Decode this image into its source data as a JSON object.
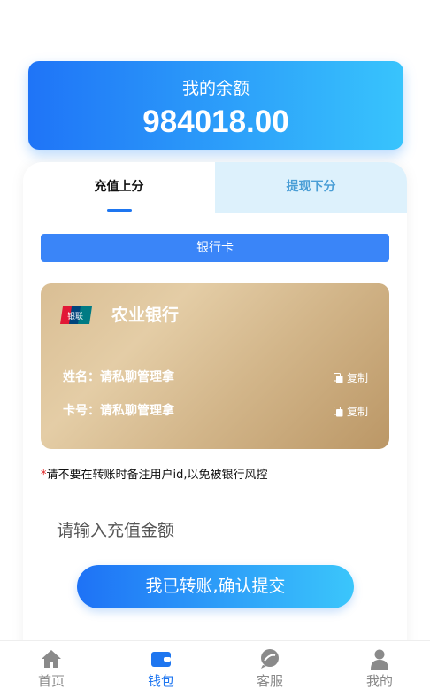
{
  "balance": {
    "title": "我的余额",
    "amount": "984018.00"
  },
  "tabs": {
    "recharge": "充值上分",
    "withdraw": "提现下分"
  },
  "payment_method": "银行卡",
  "bank_card": {
    "icon": "unionpay-logo",
    "bank_name": "农业银行",
    "name_row": "姓名：请私聊管理拿",
    "card_row": "卡号：请私聊管理拿",
    "copy_label": "复制"
  },
  "notice": {
    "star": "*",
    "text": "请不要在转账时备注用户id,以免被银行风控"
  },
  "amount_input": {
    "placeholder": "请输入充值金额",
    "value": ""
  },
  "submit_label": "我已转账,确认提交",
  "colors": {
    "primary_blue": "#1e76f0",
    "gradient_start": "#1f74f7",
    "gradient_end": "#38c4fc",
    "card_gold": "#d2b589",
    "inactive_tab_bg": "#ddf1fc",
    "notice_star": "#e02020"
  },
  "bottom_nav": {
    "home": {
      "label": "首页",
      "icon": "home-icon"
    },
    "wallet": {
      "label": "钱包",
      "icon": "wallet-icon",
      "active": true
    },
    "service": {
      "label": "客服",
      "icon": "chat-icon"
    },
    "mine": {
      "label": "我的",
      "icon": "user-icon"
    }
  }
}
